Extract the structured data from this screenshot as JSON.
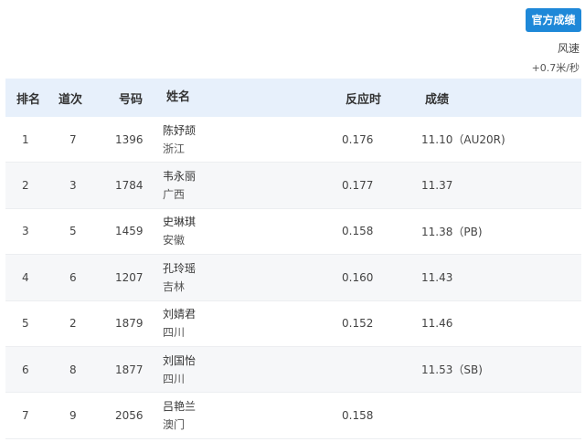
{
  "official_button": "官方成绩",
  "wind": {
    "label": "风速",
    "value": "+0.7米/秒"
  },
  "table": {
    "headers": {
      "rank": "排名",
      "lane": "道次",
      "bib": "号码",
      "name": "姓名",
      "reaction": "反应时",
      "result": "成绩"
    },
    "rows": [
      {
        "rank": "1",
        "lane": "7",
        "bib": "1396",
        "name": "陈妤颉",
        "province": "浙江",
        "reaction": "0.176",
        "result": "11.10（AU20R)"
      },
      {
        "rank": "2",
        "lane": "3",
        "bib": "1784",
        "name": "韦永丽",
        "province": "广西",
        "reaction": "0.177",
        "result": "11.37"
      },
      {
        "rank": "3",
        "lane": "5",
        "bib": "1459",
        "name": "史琳琪",
        "province": "安徽",
        "reaction": "0.158",
        "result": "11.38（PB)"
      },
      {
        "rank": "4",
        "lane": "6",
        "bib": "1207",
        "name": "孔玲瑶",
        "province": "吉林",
        "reaction": "0.160",
        "result": "11.43"
      },
      {
        "rank": "5",
        "lane": "2",
        "bib": "1879",
        "name": "刘婧君",
        "province": "四川",
        "reaction": "0.152",
        "result": "11.46"
      },
      {
        "rank": "6",
        "lane": "8",
        "bib": "1877",
        "name": "刘国怡",
        "province": "四川",
        "reaction": "",
        "result": "11.53（SB)"
      },
      {
        "rank": "7",
        "lane": "9",
        "bib": "2056",
        "name": "吕艳兰",
        "province": "澳门",
        "reaction": "0.158",
        "result": ""
      }
    ]
  },
  "colors": {
    "button": "#1e88d8",
    "header_bg": "#e7f0fb",
    "alt_row_bg": "#f6f7f9"
  }
}
